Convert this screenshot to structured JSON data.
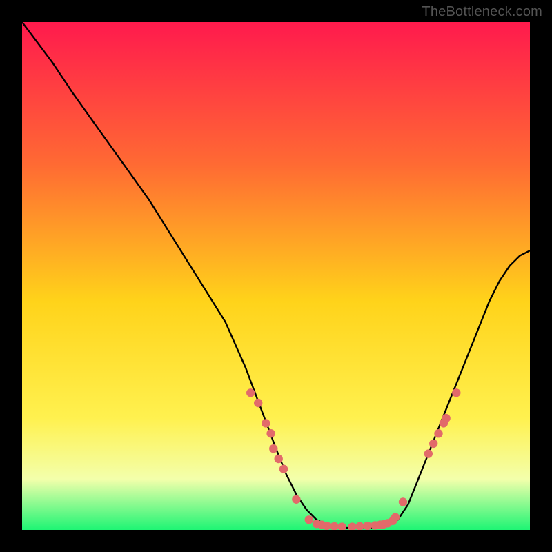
{
  "watermark": "TheBottleneck.com",
  "colors": {
    "gradient_top": "#ff1a4d",
    "gradient_mid1": "#ff6a33",
    "gradient_mid2": "#ffd31a",
    "gradient_mid3": "#fff14f",
    "gradient_mid4": "#f3ffab",
    "gradient_bottom": "#1ef574",
    "curve": "#000000",
    "dot": "#e26a6a",
    "background": "#000000"
  },
  "chart_data": {
    "type": "line",
    "title": "",
    "xlabel": "",
    "ylabel": "",
    "x": [
      0,
      3,
      6,
      10,
      15,
      20,
      25,
      30,
      35,
      40,
      44,
      47,
      50,
      52,
      54,
      56,
      58,
      60,
      62,
      64,
      66,
      68,
      70,
      72,
      74,
      76,
      78,
      80,
      82,
      84,
      86,
      88,
      90,
      92,
      94,
      96,
      98,
      100
    ],
    "y": [
      100,
      96,
      92,
      86,
      79,
      72,
      65,
      57,
      49,
      41,
      32,
      24,
      16,
      11,
      7,
      4,
      2,
      1,
      0.5,
      0.4,
      0.4,
      0.4,
      0.5,
      0.8,
      2,
      5,
      10,
      15,
      20,
      25,
      30,
      35,
      40,
      45,
      49,
      52,
      54,
      55
    ],
    "xlim": [
      0,
      100
    ],
    "ylim": [
      0,
      100
    ],
    "dots": [
      {
        "x": 45.0,
        "y": 27
      },
      {
        "x": 46.5,
        "y": 25
      },
      {
        "x": 48.0,
        "y": 21
      },
      {
        "x": 49.0,
        "y": 19
      },
      {
        "x": 49.5,
        "y": 16
      },
      {
        "x": 50.5,
        "y": 14
      },
      {
        "x": 51.5,
        "y": 12
      },
      {
        "x": 54.0,
        "y": 6
      },
      {
        "x": 56.5,
        "y": 2.0
      },
      {
        "x": 58.0,
        "y": 1.2
      },
      {
        "x": 59.0,
        "y": 1.0
      },
      {
        "x": 60.0,
        "y": 0.8
      },
      {
        "x": 61.5,
        "y": 0.7
      },
      {
        "x": 63.0,
        "y": 0.6
      },
      {
        "x": 65.0,
        "y": 0.6
      },
      {
        "x": 66.5,
        "y": 0.7
      },
      {
        "x": 68.0,
        "y": 0.8
      },
      {
        "x": 69.5,
        "y": 0.9
      },
      {
        "x": 70.5,
        "y": 1.0
      },
      {
        "x": 71.2,
        "y": 1.1
      },
      {
        "x": 72.0,
        "y": 1.3
      },
      {
        "x": 73.0,
        "y": 1.8
      },
      {
        "x": 73.5,
        "y": 2.5
      },
      {
        "x": 75.0,
        "y": 5.5
      },
      {
        "x": 80.0,
        "y": 15
      },
      {
        "x": 81.0,
        "y": 17
      },
      {
        "x": 82.0,
        "y": 19
      },
      {
        "x": 83.0,
        "y": 21
      },
      {
        "x": 83.5,
        "y": 22
      },
      {
        "x": 85.5,
        "y": 27
      }
    ]
  }
}
